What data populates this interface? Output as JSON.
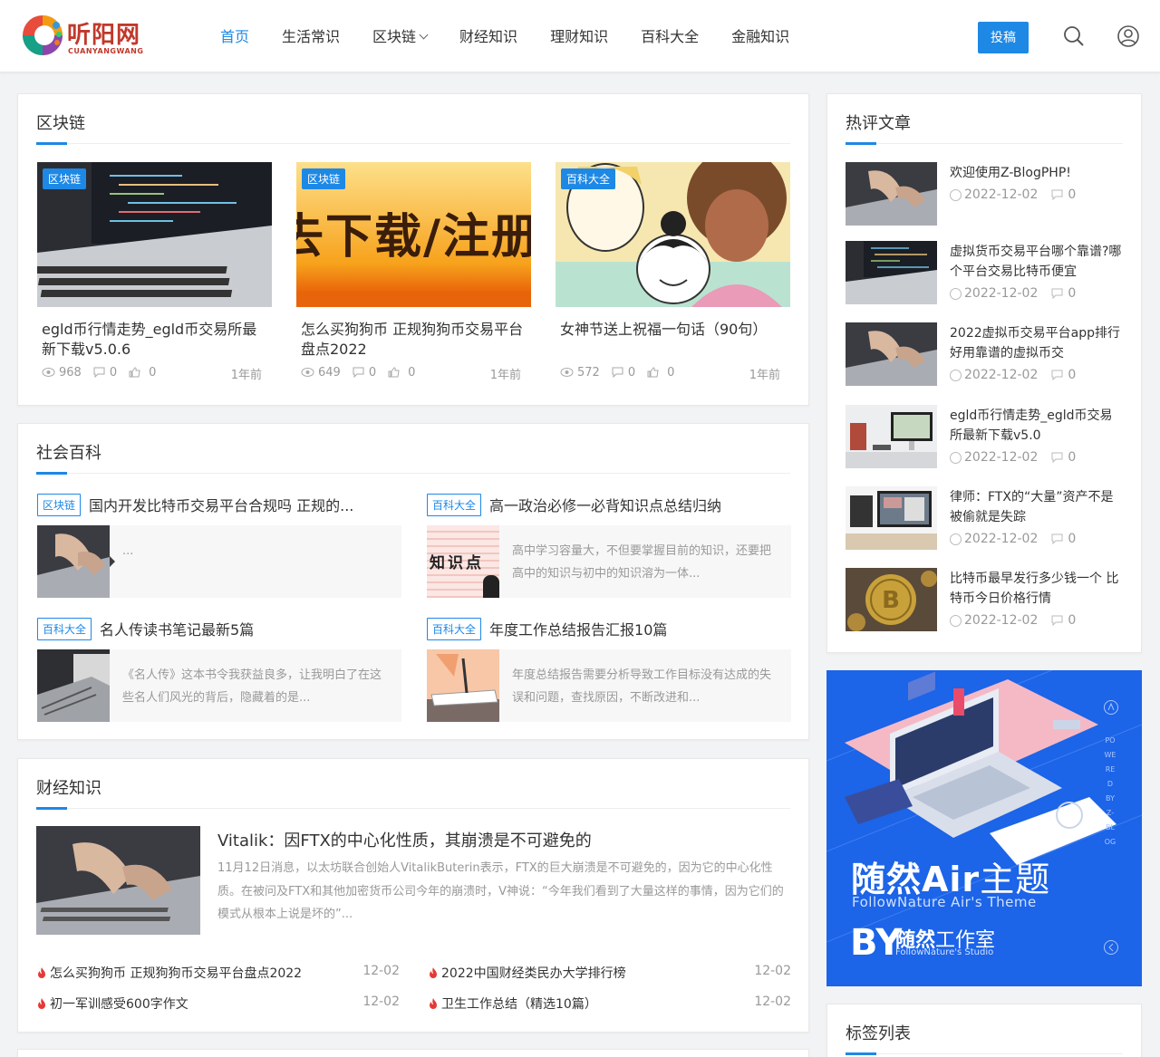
{
  "site": {
    "logo_text": "听阳网",
    "logo_sub": "CUANYANGWANG"
  },
  "nav": {
    "items": [
      {
        "label": "首页",
        "active": true
      },
      {
        "label": "生活常识"
      },
      {
        "label": "区块链",
        "has_dropdown": true
      },
      {
        "label": "财经知识"
      },
      {
        "label": "理财知识"
      },
      {
        "label": "百科大全"
      },
      {
        "label": "金融知识"
      }
    ],
    "submit_label": "投稿"
  },
  "blockchain": {
    "title": "区块链",
    "items": [
      {
        "badge": "区块链",
        "title": "egld币行情走势_egld币交易所最新下载v5.0.6",
        "views": "968",
        "comments": "0",
        "likes": "0",
        "ago": "1年前"
      },
      {
        "badge": "区块链",
        "title": "怎么买狗狗币 正规狗狗币交易平台盘点2022",
        "banner_text": "去下载/注册",
        "views": "649",
        "comments": "0",
        "likes": "0",
        "ago": "1年前"
      },
      {
        "badge": "百科大全",
        "title": "女神节送上祝福一句话（90句）",
        "views": "572",
        "comments": "0",
        "likes": "0",
        "ago": "1年前"
      }
    ]
  },
  "social": {
    "title": "社会百科",
    "items": [
      {
        "tag": "区块链",
        "title": "国内开发比特币交易平台合规吗 正规的...",
        "desc": "..."
      },
      {
        "tag": "百科大全",
        "title": "高一政治必修一必背知识点总结归纳",
        "desc": "高中学习容量大，不但要掌握目前的知识，还要把高中的知识与初中的知识溶为一体...",
        "thumb_text": "知识点"
      },
      {
        "tag": "百科大全",
        "title": "名人传读书笔记最新5篇",
        "desc": "《名人传》这本书令我获益良多，让我明白了在这些名人们风光的背后，隐藏着的是..."
      },
      {
        "tag": "百科大全",
        "title": "年度工作总结报告汇报10篇",
        "desc": "年度总结报告需要分析导致工作目标没有达成的失误和问题，查找原因，不断改进和..."
      }
    ]
  },
  "finance": {
    "title": "财经知识",
    "featured": {
      "title": "Vitalik：因FTX的中心化性质，其崩溃是不可避免的",
      "desc": "11月12日消息，以太坊联合创始人VitalikButerin表示，FTX的巨大崩溃是不可避免的，因为它的中心化性质。在被问及FTX和其他加密货币公司今年的崩溃时，V神说：“今年我们看到了大量这样的事情，因为它们的模式从根本上说是坏的”..."
    },
    "list": [
      {
        "title": "怎么买狗狗币 正规狗狗币交易平台盘点2022",
        "date": "12-02"
      },
      {
        "title": "2022中国财经类民办大学排行榜",
        "date": "12-02"
      },
      {
        "title": "初一军训感受600字作文",
        "date": "12-02"
      },
      {
        "title": "卫生工作总结（精选10篇）",
        "date": "12-02"
      }
    ]
  },
  "hot": {
    "title": "热评文章",
    "items": [
      {
        "title": "欢迎使用Z-BlogPHP!",
        "date": "2022-12-02",
        "comments": "0"
      },
      {
        "title": "虚拟货币交易平台哪个靠谱?哪个平台交易比特币便宜",
        "date": "2022-12-02",
        "comments": "0"
      },
      {
        "title": "2022虚拟币交易平台app排行好用靠谱的虚拟币交",
        "date": "2022-12-02",
        "comments": "0"
      },
      {
        "title": "egld币行情走势_egld币交易所最新下载v5.0",
        "date": "2022-12-02",
        "comments": "0"
      },
      {
        "title": "律师：FTX的“大量”资产不是被偷就是失踪",
        "date": "2022-12-02",
        "comments": "0"
      },
      {
        "title": "比特币最早发行多少钱一个 比特币今日价格行情",
        "date": "2022-12-02",
        "comments": "0"
      }
    ]
  },
  "banner": {
    "title_bold": "随然Air",
    "title_thin": "主题",
    "subtitle": "FollowNature Air's Theme",
    "by": "BY",
    "studio_bold": "随然",
    "studio_thin": "工作室",
    "studio_sub": "FollowNature's Studio",
    "vertical": "POWERED BY Z-BLOG"
  },
  "tags": {
    "title": "标签列表"
  },
  "colors": {
    "accent": "#1e88e5",
    "logo": "#c0392b",
    "banner": "#1c64e8"
  }
}
